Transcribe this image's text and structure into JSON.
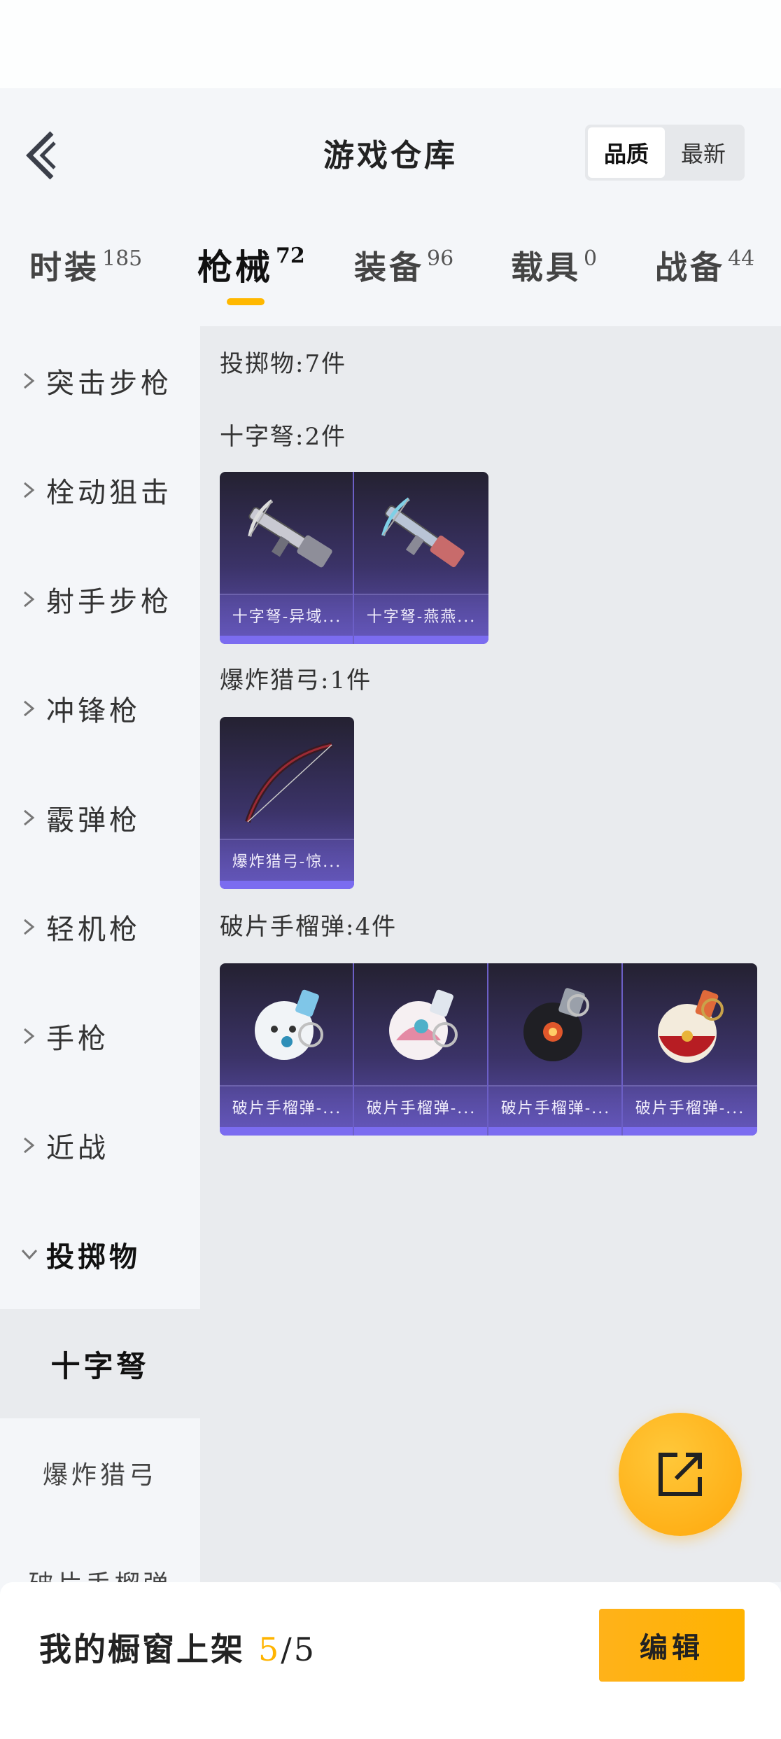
{
  "header": {
    "title": "游戏仓库",
    "sort_options": [
      "品质",
      "最新"
    ],
    "sort_selected": "品质"
  },
  "tabs": [
    {
      "label": "时装",
      "count": "185"
    },
    {
      "label": "枪械",
      "count": "72",
      "active": true
    },
    {
      "label": "装备",
      "count": "96"
    },
    {
      "label": "载具",
      "count": "0"
    },
    {
      "label": "战备",
      "count": "44"
    }
  ],
  "sidebar": {
    "categories": [
      {
        "label": "突击步枪"
      },
      {
        "label": "栓动狙击"
      },
      {
        "label": "射手步枪"
      },
      {
        "label": "冲锋枪"
      },
      {
        "label": "霰弹枪"
      },
      {
        "label": "轻机枪"
      },
      {
        "label": "手枪"
      },
      {
        "label": "近战"
      },
      {
        "label": "投掷物",
        "expanded": true
      }
    ],
    "subcategories": [
      {
        "label": "十字弩",
        "active": true
      },
      {
        "label": "爆炸猎弓"
      },
      {
        "label": "破片手榴弹"
      }
    ]
  },
  "content": {
    "summary": "投掷物:7件",
    "sections": [
      {
        "label": "十字弩:2件",
        "items": [
          {
            "name": "十字弩-异域...",
            "icon": "crossbow-icon"
          },
          {
            "name": "十字弩-燕燕...",
            "icon": "crossbow-icon"
          }
        ]
      },
      {
        "label": "爆炸猎弓:1件",
        "items": [
          {
            "name": "爆炸猎弓-惊...",
            "icon": "bow-icon"
          }
        ]
      },
      {
        "label": "破片手榴弹:4件",
        "items": [
          {
            "name": "破片手榴弹-...",
            "icon": "grenade-white-icon"
          },
          {
            "name": "破片手榴弹-...",
            "icon": "grenade-pink-icon"
          },
          {
            "name": "破片手榴弹-...",
            "icon": "grenade-black-icon"
          },
          {
            "name": "破片手榴弹-...",
            "icon": "grenade-gold-icon"
          }
        ]
      }
    ]
  },
  "fab": {
    "icon": "share-icon"
  },
  "bottom_bar": {
    "label": "我的橱窗上架",
    "current": "5",
    "separator": "/",
    "total": "5",
    "edit_label": "编辑"
  },
  "colors": {
    "accent": "#ffb400",
    "card_gradient_top": "#242131",
    "card_gradient_bottom": "#5e50b3",
    "card_bar": "#7b6cf0"
  }
}
